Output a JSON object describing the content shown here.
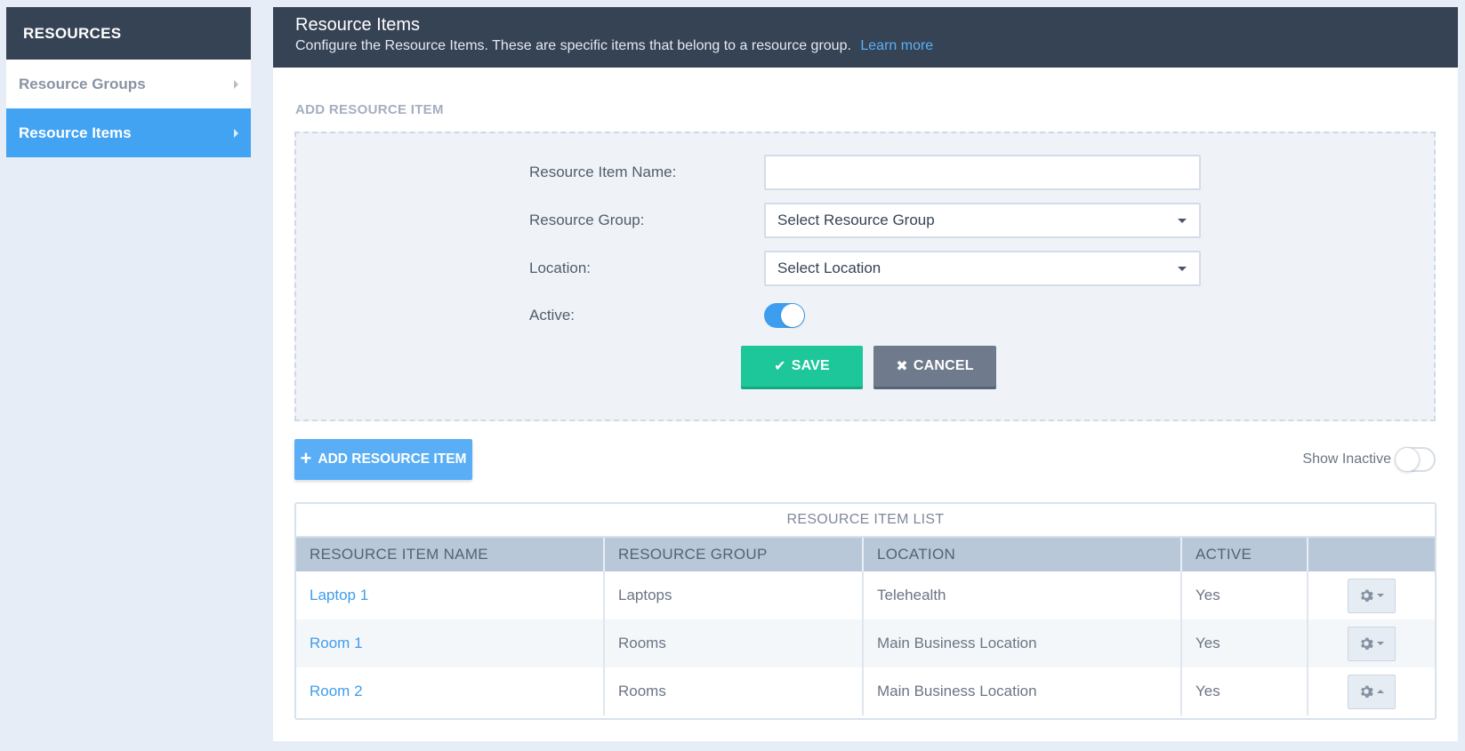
{
  "sidebar": {
    "header": "RESOURCES",
    "items": [
      {
        "label": "Resource Groups"
      },
      {
        "label": "Resource Items"
      }
    ]
  },
  "header": {
    "title": "Resource Items",
    "subtitle": "Configure the Resource Items. These are specific items that belong to a resource group.",
    "learn_more": "Learn more"
  },
  "form": {
    "section_label": "ADD RESOURCE ITEM",
    "name_label": "Resource Item Name:",
    "name_value": "",
    "group_label": "Resource Group:",
    "group_value": "Select Resource Group",
    "location_label": "Location:",
    "location_value": "Select Location",
    "active_label": "Active:",
    "active": true,
    "save_label": "SAVE",
    "cancel_label": "CANCEL"
  },
  "add_button": "ADD RESOURCE ITEM",
  "show_inactive": {
    "label": "Show Inactive",
    "on": false
  },
  "table": {
    "caption": "RESOURCE ITEM LIST",
    "headers": [
      "RESOURCE ITEM NAME",
      "RESOURCE GROUP",
      "LOCATION",
      "ACTIVE",
      ""
    ],
    "rows": [
      {
        "name": "Laptop 1",
        "group": "Laptops",
        "location": "Telehealth",
        "active": "Yes"
      },
      {
        "name": "Room 1",
        "group": "Rooms",
        "location": "Main Business Location",
        "active": "Yes"
      },
      {
        "name": "Room 2",
        "group": "Rooms",
        "location": "Main Business Location",
        "active": "Yes"
      }
    ]
  },
  "colors": {
    "accent": "#43a3f3",
    "dark_header": "#364355",
    "save": "#1dc79a",
    "cancel": "#6f7b8c"
  }
}
